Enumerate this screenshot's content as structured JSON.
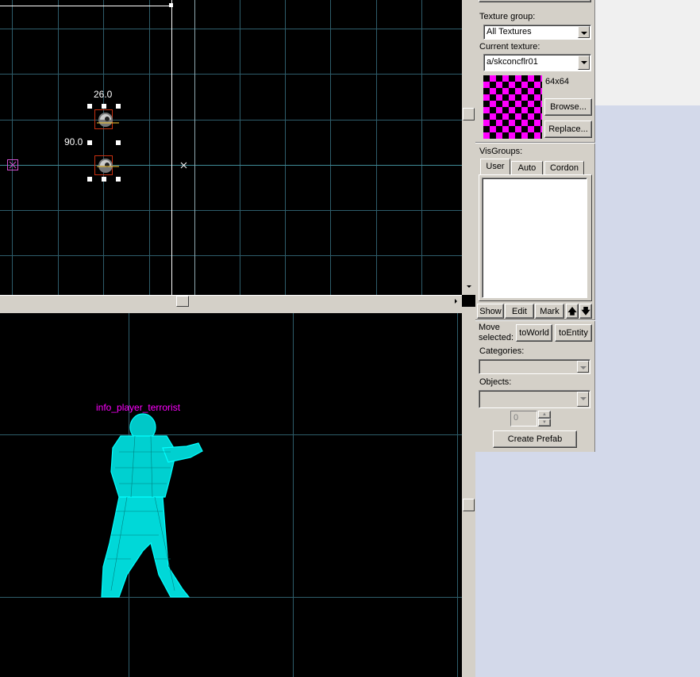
{
  "top_view": {
    "dimension_width": "26.0",
    "dimension_height": "90.0"
  },
  "bottom_view": {
    "entity_label": "info_player_terrorist"
  },
  "texture": {
    "group_label": "Texture group:",
    "group_value": "All Textures",
    "current_label": "Current texture:",
    "current_value": "a/skconcflr01",
    "size": "64x64",
    "browse_label": "Browse...",
    "replace_label": "Replace...",
    "swatch_colors": [
      "#ff00ff",
      "#000000"
    ]
  },
  "visgroups": {
    "label": "VisGroups:",
    "tabs": [
      "User",
      "Auto",
      "Cordon"
    ],
    "show_label": "Show",
    "edit_label": "Edit",
    "mark_label": "Mark",
    "up_arrow": "🡅",
    "down_arrow": "🡇"
  },
  "move_selected": {
    "label_line1": "Move",
    "label_line2": "selected:",
    "to_world": "toWorld",
    "to_entity": "toEntity"
  },
  "prefab": {
    "categories_label": "Categories:",
    "objects_label": "Objects:",
    "count_value": "0",
    "create_label": "Create Prefab"
  },
  "colors": {
    "grid": "#2e5d6b",
    "wireframe": "#00ffff",
    "entity_label": "#ff00ff",
    "panel": "#d4d0c8",
    "desktop": "#d3d9ea"
  }
}
